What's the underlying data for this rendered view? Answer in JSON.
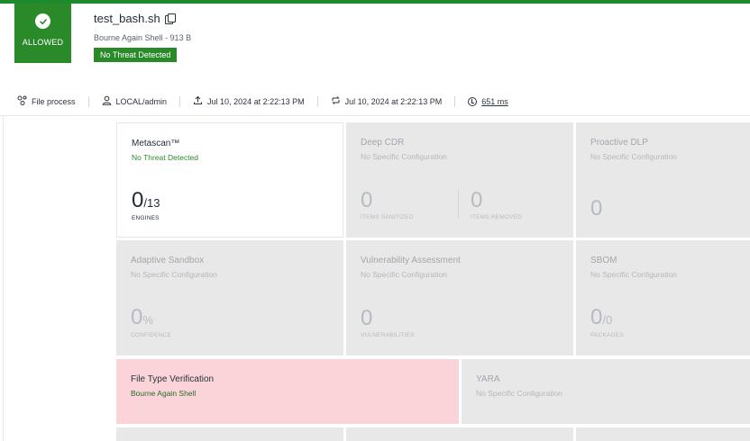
{
  "header": {
    "verdict": "ALLOWED",
    "file_name": "test_bash.sh",
    "file_type": "Bourne Again Shell - 913 B",
    "badge": "No Threat Detected"
  },
  "meta": {
    "source": "File process",
    "user": "LOCAL/admin",
    "upload_time": "Jul 10, 2024 at 2:22:13 PM",
    "process_time": "Jul 10, 2024 at 2:22:13 PM",
    "duration": "651 ms"
  },
  "cards": {
    "metascan": {
      "title": "Metascan™",
      "sub": "No Threat Detected",
      "value": "0",
      "total": "/13",
      "caption": "ENGINES"
    },
    "deep_cdr": {
      "title": "Deep CDR",
      "sub": "No Specific Configuration",
      "sanitized": "0",
      "sanitized_caption": "ITEMS SANITIZED",
      "removed": "0",
      "removed_caption": "ITEMS REMOVED"
    },
    "dlp": {
      "title": "Proactive DLP",
      "sub": "No Specific Configuration",
      "value": "0"
    },
    "sandbox": {
      "title": "Adaptive Sandbox",
      "sub": "No Specific Configuration",
      "value": "0",
      "unit": "%",
      "caption": "CONFIDENCE"
    },
    "vuln": {
      "title": "Vulnerability Assessment",
      "sub": "No Specific Configuration",
      "value": "0",
      "caption": "VULNERABILITIES"
    },
    "sbom": {
      "title": "SBOM",
      "sub": "No Specific Configuration",
      "value": "0",
      "total": "/0",
      "caption": "PACKAGES"
    },
    "ftv": {
      "title": "File Type Verification",
      "sub": "Bourne Again Shell"
    },
    "yara": {
      "title": "YARA",
      "sub": "No Specific Configuration"
    }
  }
}
